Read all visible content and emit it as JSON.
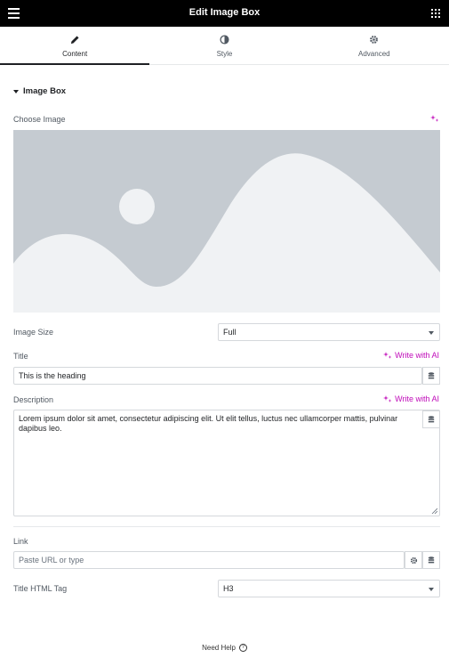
{
  "header": {
    "title": "Edit Image Box",
    "menu_icon": "hamburger-icon",
    "grid_icon": "apps-grid-icon"
  },
  "tabs": [
    {
      "label": "Content",
      "icon": "pencil-icon",
      "active": true
    },
    {
      "label": "Style",
      "icon": "half-circle-icon",
      "active": false
    },
    {
      "label": "Advanced",
      "icon": "gear-icon",
      "active": false
    }
  ],
  "section": {
    "title": "Image Box"
  },
  "image": {
    "label": "Choose Image",
    "ai_icon": "ai-sparkle-icon"
  },
  "image_size": {
    "label": "Image Size",
    "value": "Full"
  },
  "title_field": {
    "label": "Title",
    "ai_label": "Write with AI",
    "value": "This is the heading"
  },
  "description": {
    "label": "Description",
    "ai_label": "Write with AI",
    "value": "Lorem ipsum dolor sit amet, consectetur adipiscing elit. Ut elit tellus, luctus nec ullamcorper mattis, pulvinar dapibus leo."
  },
  "link": {
    "label": "Link",
    "placeholder": "Paste URL or type"
  },
  "html_tag": {
    "label": "Title HTML Tag",
    "value": "H3"
  },
  "footer": {
    "help_label": "Need Help",
    "help_icon": "question-circle-icon"
  },
  "colors": {
    "header_bg": "#000000",
    "accent_ai": "#c00bb9",
    "placeholder_bg": "#c5cbd1",
    "placeholder_fg": "#f0f2f4"
  }
}
